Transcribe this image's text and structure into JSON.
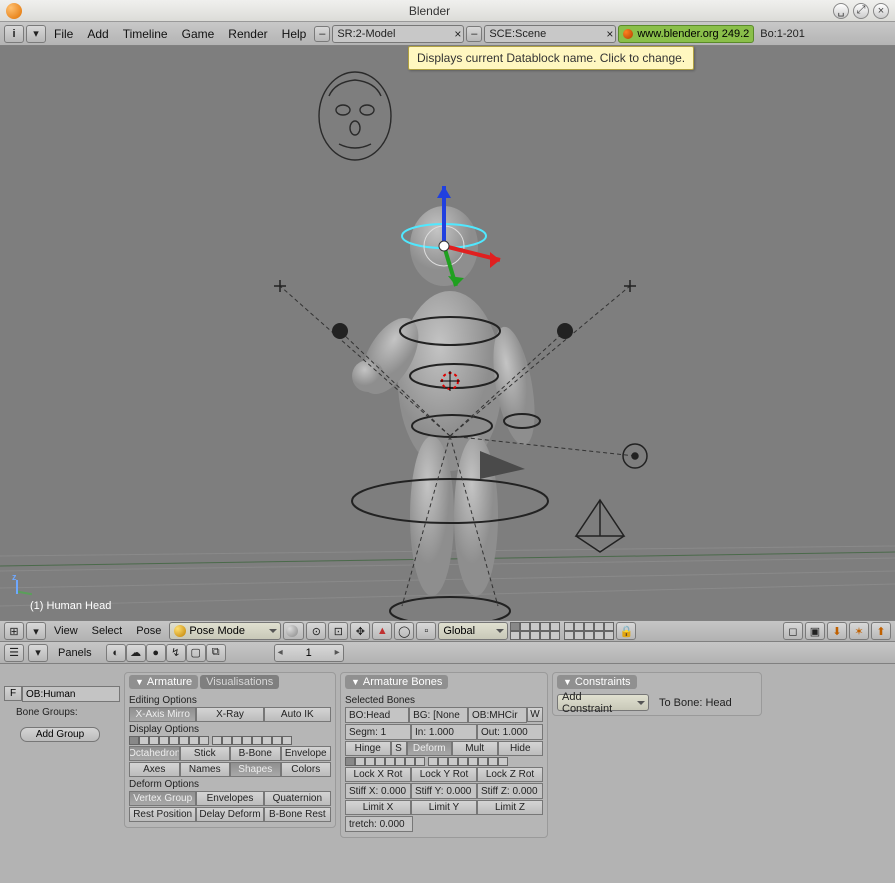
{
  "title": "Blender",
  "tooltip": "Displays current Datablock name. Click to change.",
  "menu": {
    "file": "File",
    "add": "Add",
    "timeline": "Timeline",
    "game": "Game",
    "render": "Render",
    "help": "Help"
  },
  "screen_field": "SR:2-Model",
  "scene_field": "SCE:Scene",
  "url": "www.blender.org 249.2",
  "stats": "Bo:1-201",
  "viewport_label": "(1) Human Head",
  "vpheader": {
    "view": "View",
    "select": "Select",
    "pose": "Pose",
    "mode": "Pose Mode",
    "orient": "Global"
  },
  "bheader": {
    "panels": "Panels",
    "frame": "1"
  },
  "objpanel": {
    "ob": "OB:Human",
    "f": "F",
    "bg_label": "Bone Groups:",
    "add": "Add Group"
  },
  "armature": {
    "tab1": "Armature",
    "tab2": "Visualisations",
    "edit_lbl": "Editing Options",
    "xmirror": "X-Axis Mirro",
    "xray": "X-Ray",
    "autoik": "Auto IK",
    "disp_lbl": "Display Options",
    "oct": "Octahedron",
    "stick": "Stick",
    "bbone": "B-Bone",
    "env": "Envelope",
    "axes": "Axes",
    "names": "Names",
    "shapes": "Shapes",
    "colors": "Colors",
    "def_lbl": "Deform Options",
    "vg": "Vertex Group",
    "envd": "Envelopes",
    "quat": "Quaternion",
    "rest": "Rest Position",
    "delay": "Delay Deform",
    "bbrest": "B-Bone Rest"
  },
  "bones": {
    "title": "Armature Bones",
    "sel": "Selected Bones",
    "bo": "BO:Head",
    "bg": "BG: [None",
    "ob": "OB:MHCir",
    "w": "W",
    "segm": "Segm: 1",
    "in": "In: 1.000",
    "out": "Out: 1.000",
    "hinge": "Hinge",
    "s": "S",
    "deform": "Deform",
    "mult": "Mult",
    "hide": "Hide",
    "lockx": "Lock X Rot",
    "locky": "Lock Y Rot",
    "lockz": "Lock Z Rot",
    "stiffx": "Stiff X: 0.000",
    "stiffy": "Stiff Y: 0.000",
    "stiffz": "Stiff Z: 0.000",
    "limx": "Limit X",
    "limy": "Limit Y",
    "limz": "Limit Z",
    "stretch": "tretch: 0.000"
  },
  "constraints": {
    "title": "Constraints",
    "add": "Add Constraint",
    "tobone": "To Bone: Head"
  }
}
